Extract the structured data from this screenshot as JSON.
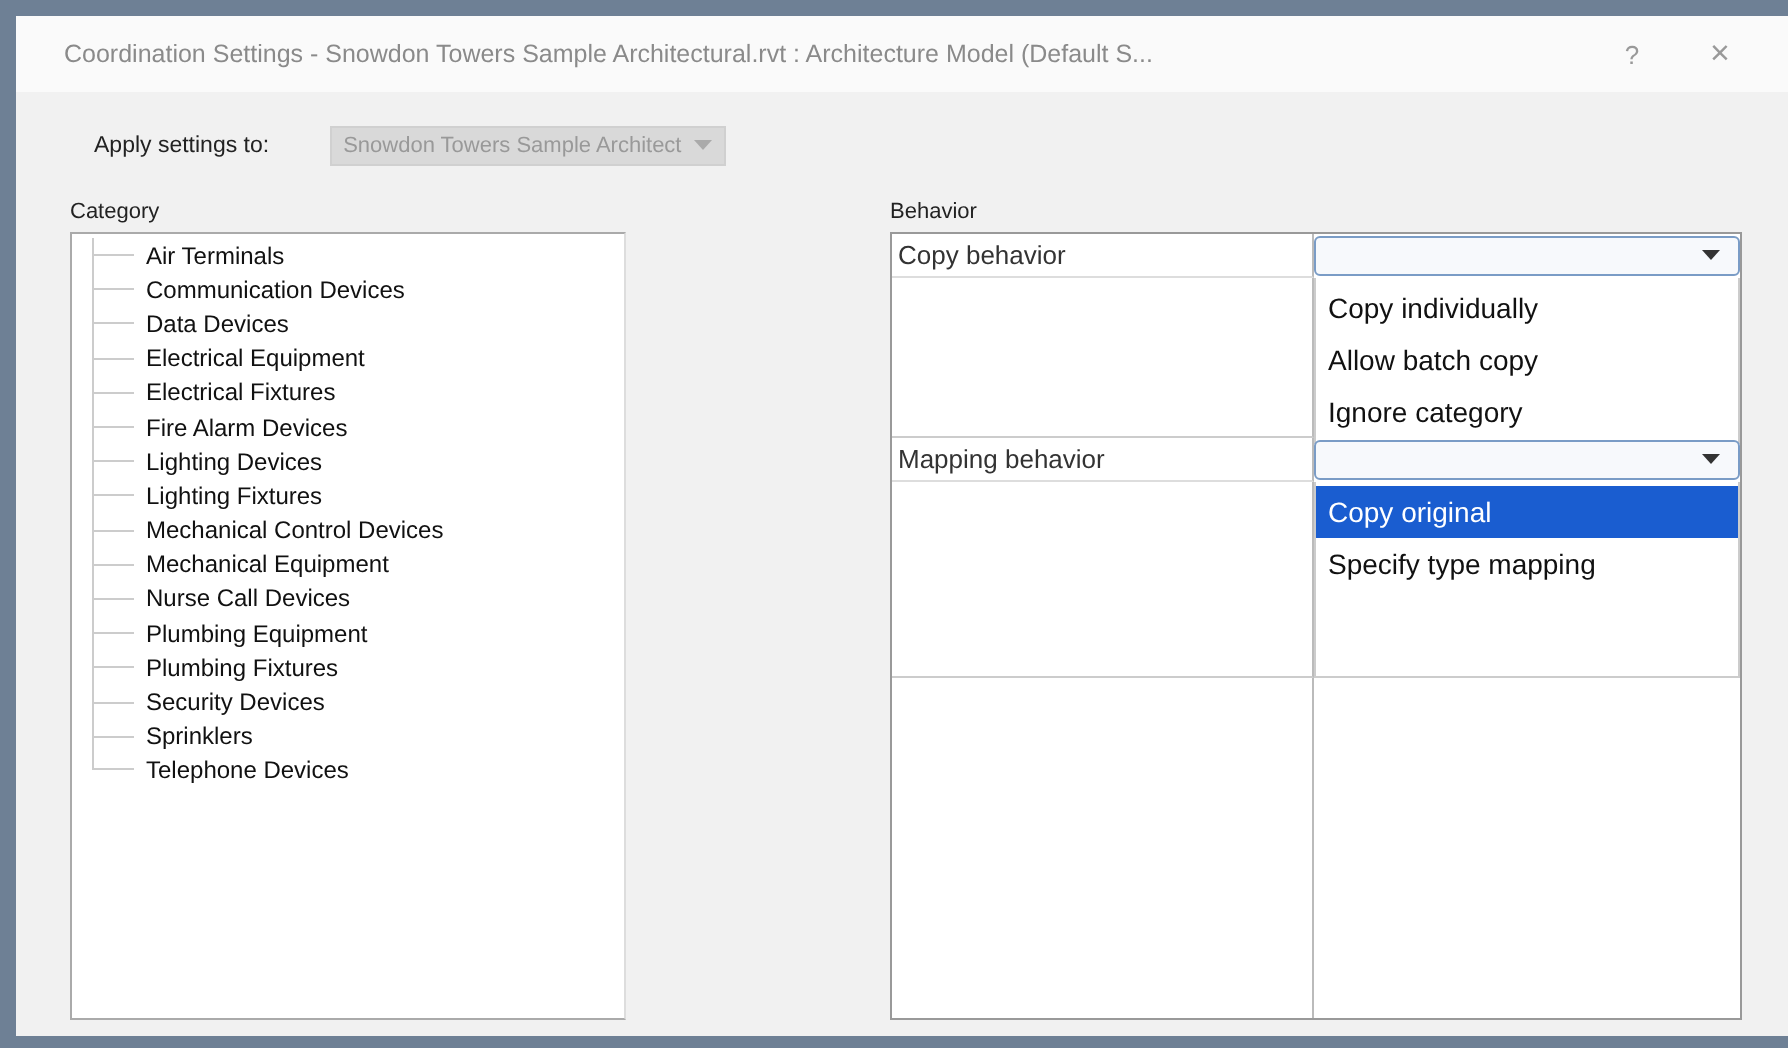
{
  "window": {
    "title": "Coordination Settings - Snowdon Towers Sample Architectural.rvt : Architecture Model (Default S...",
    "help": "?",
    "close": "×"
  },
  "apply_settings": {
    "label": "Apply settings to:",
    "value": "Snowdon Towers Sample Architect",
    "disabled": true
  },
  "category": {
    "label": "Category",
    "items": [
      {
        "label": "Air Terminals"
      },
      {
        "label": "Communication Devices"
      },
      {
        "label": "Data Devices"
      },
      {
        "label": "Electrical Equipment"
      },
      {
        "label": "Electrical Fixtures"
      },
      {
        "label": "Fire Alarm Devices"
      },
      {
        "label": "Lighting Devices"
      },
      {
        "label": "Lighting Fixtures"
      },
      {
        "label": "Mechanical Control Devices"
      },
      {
        "label": "Mechanical Equipment"
      },
      {
        "label": "Nurse Call Devices"
      },
      {
        "label": "Plumbing Equipment"
      },
      {
        "label": "Plumbing Fixtures"
      },
      {
        "label": "Security Devices"
      },
      {
        "label": "Sprinklers"
      },
      {
        "label": "Telephone Devices"
      }
    ]
  },
  "behavior": {
    "label": "Behavior",
    "rows": [
      {
        "label": "Copy behavior",
        "expanded": true,
        "options": [
          {
            "label": "Copy individually",
            "selected": false
          },
          {
            "label": "Allow batch copy",
            "selected": false
          },
          {
            "label": "Ignore category",
            "selected": false
          }
        ]
      },
      {
        "label": "Mapping behavior",
        "expanded": true,
        "options": [
          {
            "label": "Copy original",
            "selected": true
          },
          {
            "label": "Specify type mapping",
            "selected": false
          }
        ]
      }
    ]
  }
}
